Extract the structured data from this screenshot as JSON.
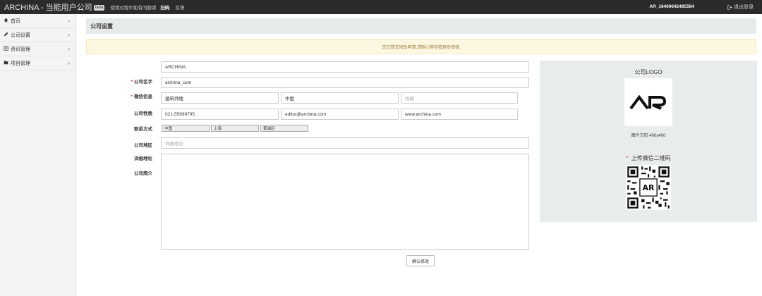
{
  "topbar": {
    "brand": "ARCHINA - 当能用户公司",
    "badge": "beta",
    "link1": "使用过程中如有问题请",
    "link2": "扫码",
    "link3": "反馈",
    "account": "AR_16469642485584",
    "logout": "退出登录"
  },
  "sidebar": {
    "items": [
      {
        "icon": "home-icon",
        "label": "首页"
      },
      {
        "icon": "pencil-icon",
        "label": "公司设置"
      },
      {
        "icon": "list-icon",
        "label": "资讯管理"
      },
      {
        "icon": "folder-icon",
        "label": "项目管理"
      }
    ]
  },
  "page": {
    "title": "公司设置",
    "notice": "您已提交修改申请,请耐心等待管理员审核."
  },
  "form": {
    "company_name": {
      "label": "公司名字",
      "value": "ARCHINA",
      "required": true
    },
    "wechat": {
      "label": "微信信息",
      "value": "archina_com",
      "required": true
    },
    "nature": {
      "label": "公司性质",
      "values": [
        "建筑师楼",
        "中国",
        ""
      ],
      "placeholders": [
        "",
        "",
        "规模"
      ]
    },
    "contact": {
      "label": "联系方式",
      "values": [
        "021-55698795",
        "editor@archina.com",
        "www.archina.com"
      ]
    },
    "region": {
      "label": "公司地区",
      "values": [
        "中国",
        "上海",
        "黄浦区"
      ]
    },
    "address": {
      "label": "详细地址",
      "placeholder": "详细地址"
    },
    "intro": {
      "label": "公司简介",
      "value": ""
    },
    "submit": "确认修改"
  },
  "right_panel": {
    "logo_title": "公司LOGO",
    "logo_caption": "图片方形 400x400",
    "qr_title": "上传微信二维码",
    "logo_text": "AR"
  }
}
